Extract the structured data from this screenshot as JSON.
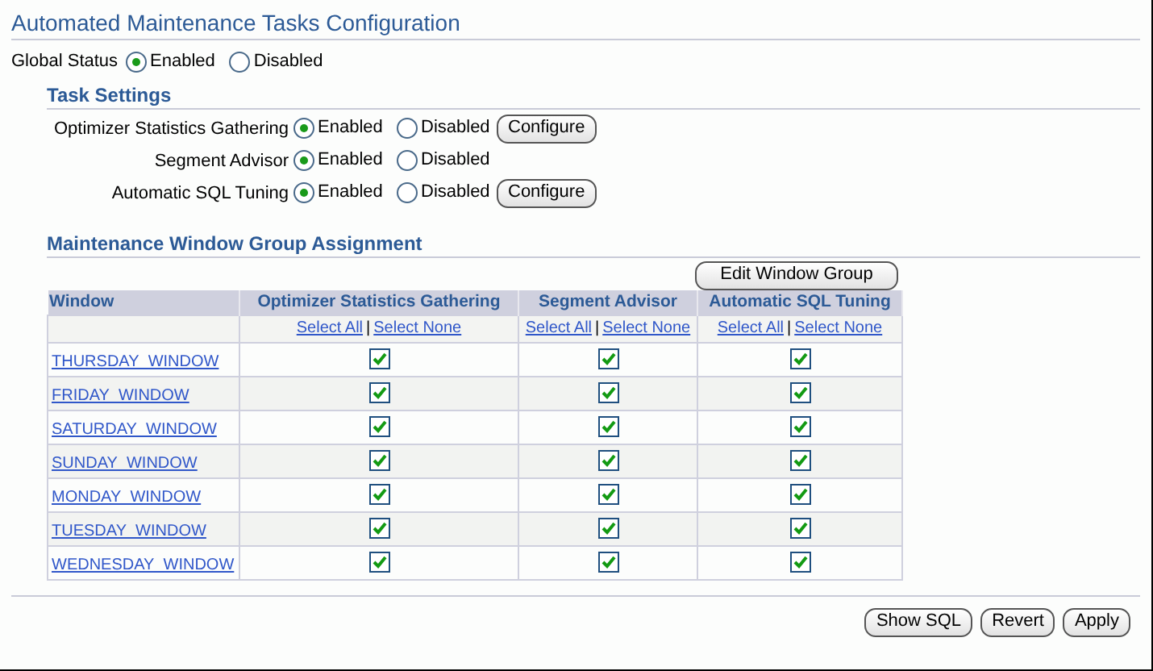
{
  "title": "Automated Maintenance Tasks Configuration",
  "global_status": {
    "label": "Global Status",
    "options": [
      {
        "label": "Enabled",
        "selected": true
      },
      {
        "label": "Disabled",
        "selected": false
      }
    ]
  },
  "task_settings": {
    "heading": "Task Settings",
    "tasks": [
      {
        "label": "Optimizer Statistics Gathering",
        "options": [
          {
            "label": "Enabled",
            "selected": true
          },
          {
            "label": "Disabled",
            "selected": false
          }
        ],
        "button": "Configure"
      },
      {
        "label": "Segment Advisor",
        "options": [
          {
            "label": "Enabled",
            "selected": true
          },
          {
            "label": "Disabled",
            "selected": false
          }
        ]
      },
      {
        "label": "Automatic SQL Tuning",
        "options": [
          {
            "label": "Enabled",
            "selected": true
          },
          {
            "label": "Disabled",
            "selected": false
          }
        ],
        "button": "Configure"
      }
    ]
  },
  "window_group": {
    "heading": "Maintenance Window Group Assignment",
    "edit_button": "Edit Window Group",
    "columns": [
      "Window",
      "Optimizer Statistics Gathering",
      "Segment Advisor",
      "Automatic SQL Tuning"
    ],
    "select_links": [
      {
        "all": "Select All",
        "separator": "|",
        "none": "Select None"
      },
      {
        "all": "Select All",
        "separator": "|",
        "none": "Select None"
      },
      {
        "all": "Select All",
        "separator": "|",
        "none": "Select None"
      }
    ],
    "rows": [
      {
        "window": "THURSDAY_WINDOW",
        "checks": [
          {
            "checked": true
          },
          {
            "checked": true
          },
          {
            "checked": true
          }
        ]
      },
      {
        "window": "FRIDAY_WINDOW",
        "checks": [
          {
            "checked": true
          },
          {
            "checked": true
          },
          {
            "checked": true
          }
        ]
      },
      {
        "window": "SATURDAY_WINDOW",
        "checks": [
          {
            "checked": true
          },
          {
            "checked": true
          },
          {
            "checked": true
          }
        ]
      },
      {
        "window": "SUNDAY_WINDOW",
        "checks": [
          {
            "checked": true
          },
          {
            "checked": true
          },
          {
            "checked": true
          }
        ]
      },
      {
        "window": "MONDAY_WINDOW",
        "checks": [
          {
            "checked": true
          },
          {
            "checked": true
          },
          {
            "checked": true
          }
        ]
      },
      {
        "window": "TUESDAY_WINDOW",
        "checks": [
          {
            "checked": true
          },
          {
            "checked": true
          },
          {
            "checked": true
          }
        ]
      },
      {
        "window": "WEDNESDAY_WINDOW",
        "checks": [
          {
            "checked": true
          },
          {
            "checked": true
          },
          {
            "checked": true
          }
        ]
      }
    ]
  },
  "buttons": [
    "Show SQL",
    "Revert",
    "Apply"
  ]
}
